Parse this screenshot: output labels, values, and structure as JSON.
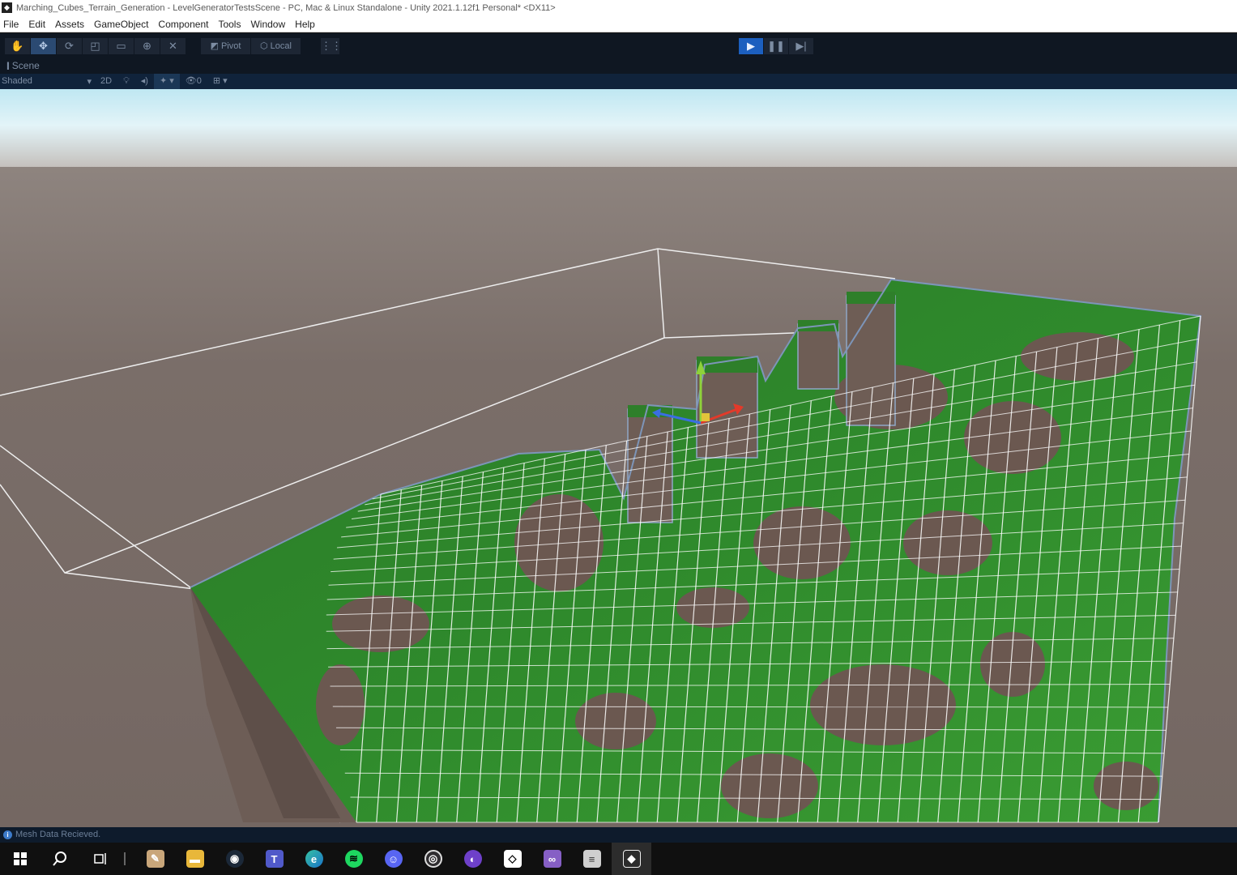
{
  "window": {
    "title": "Marching_Cubes_Terrain_Generation - LevelGeneratorTestsScene - PC, Mac & Linux Standalone - Unity 2021.1.12f1 Personal* <DX11>"
  },
  "menu": [
    "File",
    "Edit",
    "Assets",
    "GameObject",
    "Component",
    "Tools",
    "Window",
    "Help"
  ],
  "toolbar": {
    "pivot_label": "Pivot",
    "local_label": "Local"
  },
  "scene": {
    "tab_label": "Scene",
    "shading_mode": "Shaded",
    "mode_2d": "2D",
    "hidden_count": "0"
  },
  "status": {
    "message": "Mesh Data Recieved."
  },
  "taskbar": {
    "icons": [
      "windows-start-icon",
      "search-icon",
      "task-view-icon",
      "paint-icon",
      "file-explorer-icon",
      "steam-icon",
      "teams-icon",
      "edge-icon",
      "spotify-icon",
      "discord-icon",
      "obs-icon",
      "github-desktop-icon",
      "unity-hub-icon",
      "visual-studio-icon",
      "notes-icon",
      "unity-editor-icon"
    ]
  },
  "colors": {
    "accent_play": "#1c5fbf",
    "grass": "#2f7a2b",
    "ground_bg": "#776a64",
    "sky": "#dff3f8"
  }
}
